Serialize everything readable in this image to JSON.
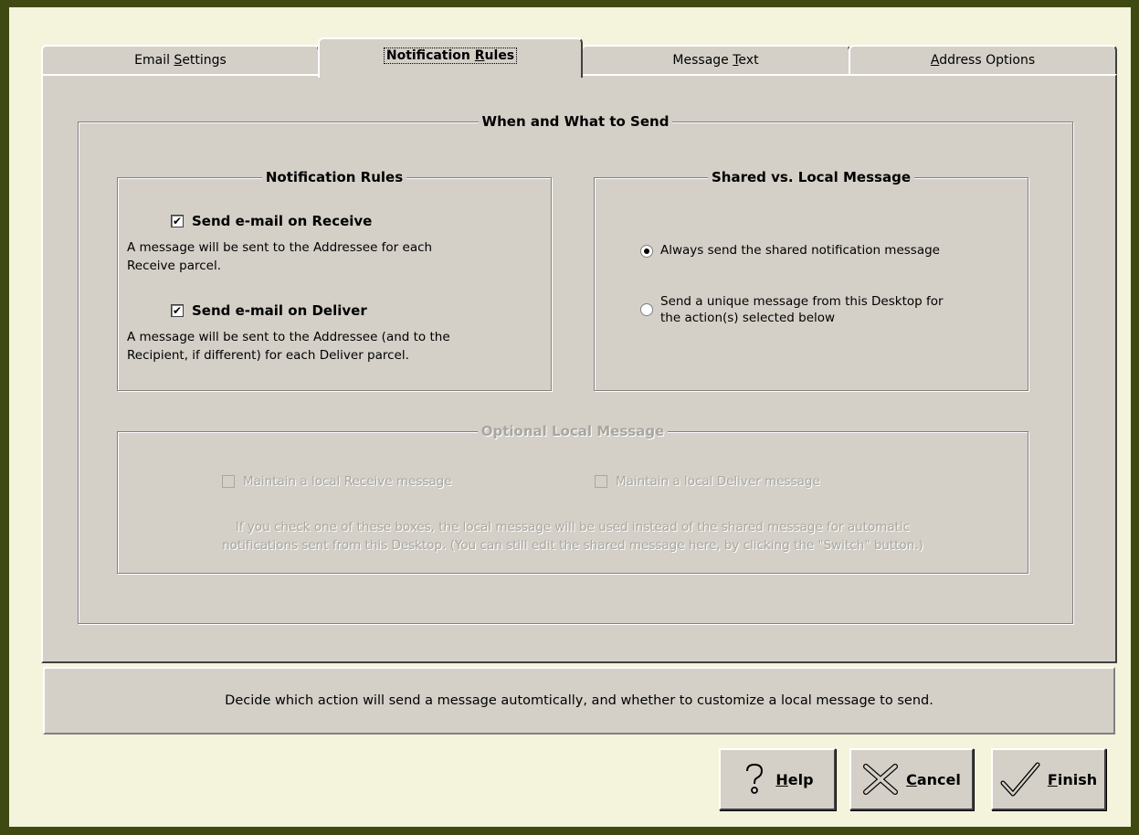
{
  "tabs": [
    {
      "label_pre": "Email ",
      "label_u": "S",
      "label_post": "ettings"
    },
    {
      "label_pre": "Notification ",
      "label_u": "R",
      "label_post": "ules",
      "active": true
    },
    {
      "label_pre": "Message ",
      "label_u": "T",
      "label_post": "ext"
    },
    {
      "label_pre": "",
      "label_u": "A",
      "label_post": "ddress Options"
    }
  ],
  "main_group": {
    "title": "When and What to Send"
  },
  "rules_group": {
    "title": "Notification Rules",
    "receive": {
      "label": "Send e-mail on Receive",
      "checked": true,
      "desc1": "A message will be sent to the Addressee for each",
      "desc2": "Receive parcel."
    },
    "deliver": {
      "label": "Send e-mail on Deliver",
      "checked": true,
      "desc1": "A message will be sent to the Addressee (and to the",
      "desc2": "Recipient, if different) for each Deliver parcel."
    }
  },
  "shared_group": {
    "title": "Shared vs. Local Message",
    "option1": {
      "label": "Always send the shared notification message",
      "selected": true
    },
    "option2": {
      "line1": "Send a unique message from this Desktop for",
      "line2": "the action(s) selected below",
      "selected": false
    }
  },
  "optional_group": {
    "title": "Optional Local Message",
    "receive_label": "Maintain a local Receive message",
    "deliver_label": "Maintain a local Deliver message",
    "note1": "If you check one of these boxes, the local message will be used instead of the shared message for automatic",
    "note2": "notifications sent from this Desktop.  (You can still edit the shared message here, by clicking the \"Switch\" button.)"
  },
  "status_text": "Decide which action will send a message automtically, and whether to customize a local message to send.",
  "buttons": {
    "help": {
      "u": "H",
      "rest": "elp",
      "icon": "question-icon"
    },
    "cancel": {
      "u": "C",
      "rest": "ancel",
      "icon": "x-icon"
    },
    "finish": {
      "u": "F",
      "rest": "inish",
      "icon": "checkmark-icon"
    }
  }
}
